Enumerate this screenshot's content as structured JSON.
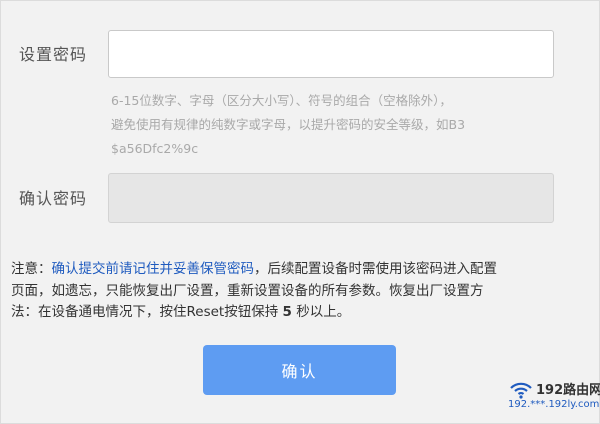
{
  "form": {
    "password_label": "设置密码",
    "password_value": "",
    "hint_line1": "6-15位数字、字母（区分大小写）、符号的组合（空格除外），",
    "hint_line2": "避免使用有规律的纯数字或字母，以提升密码的安全等级，如B3",
    "hint_line3": "$a56Dfc2%9c",
    "confirm_label": "确认密码",
    "confirm_value": ""
  },
  "note": {
    "prefix": "注意：",
    "emphasis": "确认提交前请记住并妥善保管密码",
    "line1_rest": "，后续配置设备时需使用该密码进入配置",
    "line2": "页面，如遗忘，只能恢复出厂设置，重新设置设备的所有参数。恢复出厂设置方",
    "line3_start": "法：在设备通电情况下，按住Reset按钮保持",
    "seconds": "5",
    "line3_end": "秒以上。"
  },
  "submit_label": "确认",
  "watermark": {
    "title": "192路由网",
    "url": "192.***.192ly.com",
    "icon": "wifi-icon",
    "accent": "#1f5bbf"
  },
  "colors": {
    "button": "#5e9cf2",
    "emphasis": "#1f5bbf",
    "hint": "#a9a9a9"
  }
}
